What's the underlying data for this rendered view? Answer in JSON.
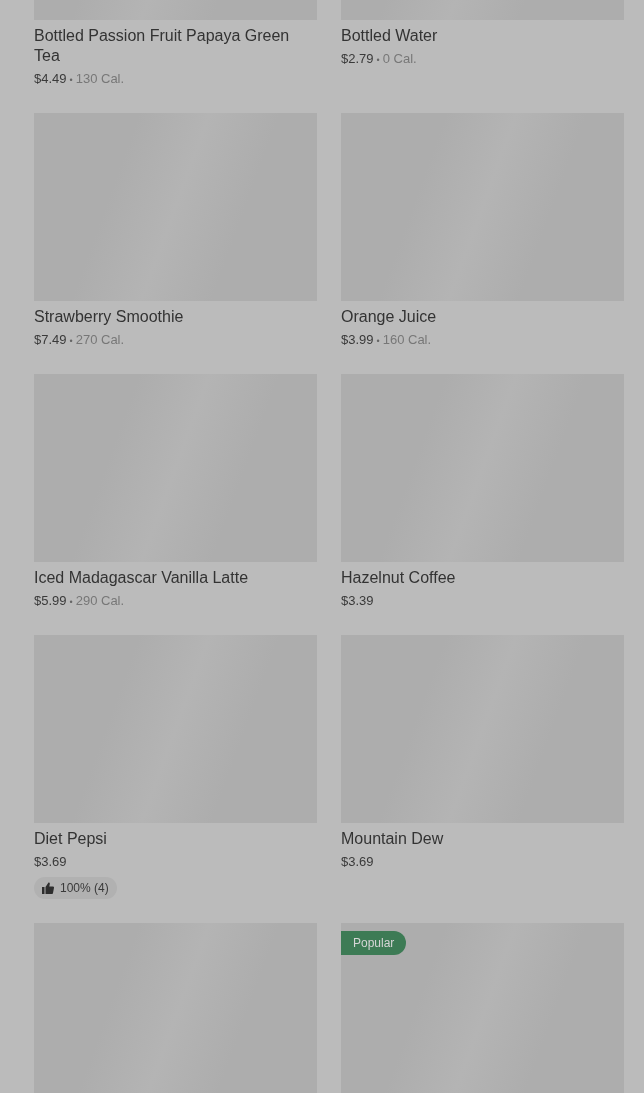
{
  "items": [
    {
      "kind": "skeleton",
      "name": "Bottled Passion Fruit Papaya Green Tea",
      "price": "$4.49",
      "separator": "•",
      "calories": "130 Cal."
    },
    {
      "kind": "skeleton",
      "name": "Bottled Water",
      "price": "$2.79",
      "separator": "•",
      "calories": "0 Cal."
    },
    {
      "kind": "skeleton",
      "name": "Strawberry Smoothie",
      "price": "$7.49",
      "separator": "•",
      "calories": "270 Cal."
    },
    {
      "kind": "skeleton",
      "name": "Orange Juice",
      "price": "$3.99",
      "separator": "•",
      "calories": "160 Cal."
    },
    {
      "kind": "skeleton",
      "name": "Iced Madagascar Vanilla Latte",
      "price": "$5.99",
      "separator": "•",
      "calories": "290 Cal."
    },
    {
      "kind": "skeleton",
      "name": "Hazelnut Coffee",
      "price": "$3.39"
    },
    {
      "kind": "skeleton",
      "name": "Diet Pepsi",
      "price": "$3.69",
      "rating": "100% (4)"
    },
    {
      "kind": "skeleton",
      "name": "Mountain Dew",
      "price": "$3.69"
    },
    {
      "kind": "skeleton"
    },
    {
      "kind": "skeleton",
      "badge": "Popular"
    }
  ]
}
